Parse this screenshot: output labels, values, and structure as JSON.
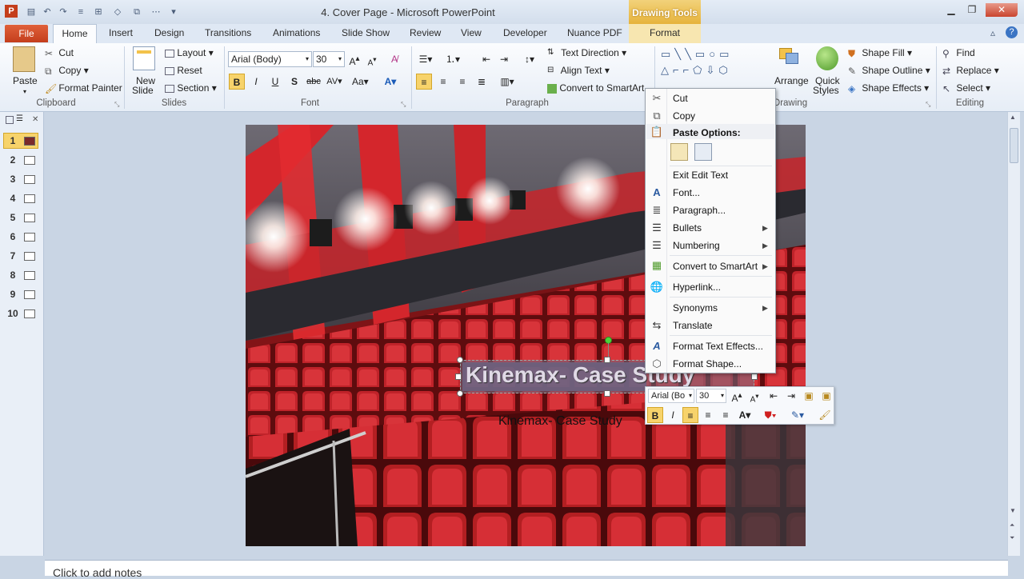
{
  "app": {
    "window_title": "4. Cover Page - Microsoft PowerPoint",
    "contextual_tab_group": "Drawing Tools",
    "app_icon": "P"
  },
  "tabs": {
    "file": "File",
    "home": "Home",
    "insert": "Insert",
    "design": "Design",
    "transitions": "Transitions",
    "animations": "Animations",
    "slide_show": "Slide Show",
    "review": "Review",
    "view": "View",
    "developer": "Developer",
    "nuance": "Nuance PDF",
    "format": "Format"
  },
  "ribbon": {
    "clipboard": {
      "label": "Clipboard",
      "paste": "Paste",
      "cut": "Cut",
      "copy": "Copy",
      "format_painter": "Format Painter"
    },
    "slides": {
      "label": "Slides",
      "new_slide_1": "New",
      "new_slide_2": "Slide",
      "layout": "Layout",
      "reset": "Reset",
      "section": "Section"
    },
    "font": {
      "label": "Font",
      "font_name": "Arial (Body)",
      "font_size": "30"
    },
    "paragraph": {
      "label": "Paragraph",
      "text_direction": "Text Direction",
      "align_text": "Align Text",
      "convert_smartart": "Convert to SmartArt"
    },
    "drawing": {
      "label": "Drawing",
      "arrange": "Arrange",
      "quick_styles_1": "Quick",
      "quick_styles_2": "Styles",
      "shape_fill": "Shape Fill",
      "shape_outline": "Shape Outline",
      "shape_effects": "Shape Effects"
    },
    "editing": {
      "label": "Editing",
      "find": "Find",
      "replace": "Replace",
      "select": "Select"
    }
  },
  "thumbnails": [
    "1",
    "2",
    "3",
    "4",
    "5",
    "6",
    "7",
    "8",
    "9",
    "10"
  ],
  "slide": {
    "title_text": "Kinemax- Case Study",
    "subtitle_text": "Kinemax- Case Study"
  },
  "notes": {
    "placeholder": "Click to add notes"
  },
  "context_menu": {
    "cut": "Cut",
    "copy": "Copy",
    "paste_options": "Paste Options:",
    "exit_edit": "Exit Edit Text",
    "font": "Font...",
    "paragraph": "Paragraph...",
    "bullets": "Bullets",
    "numbering": "Numbering",
    "convert_smartart": "Convert to SmartArt",
    "hyperlink": "Hyperlink...",
    "synonyms": "Synonyms",
    "translate": "Translate",
    "format_text_effects": "Format Text Effects...",
    "format_shape": "Format Shape..."
  },
  "mini_toolbar": {
    "font_name": "Arial (Bo",
    "font_size": "30"
  },
  "colors": {
    "file_tab": "#c43e1c",
    "drawing_tools": "#e6b33c",
    "seat_red": "#b31f22"
  }
}
